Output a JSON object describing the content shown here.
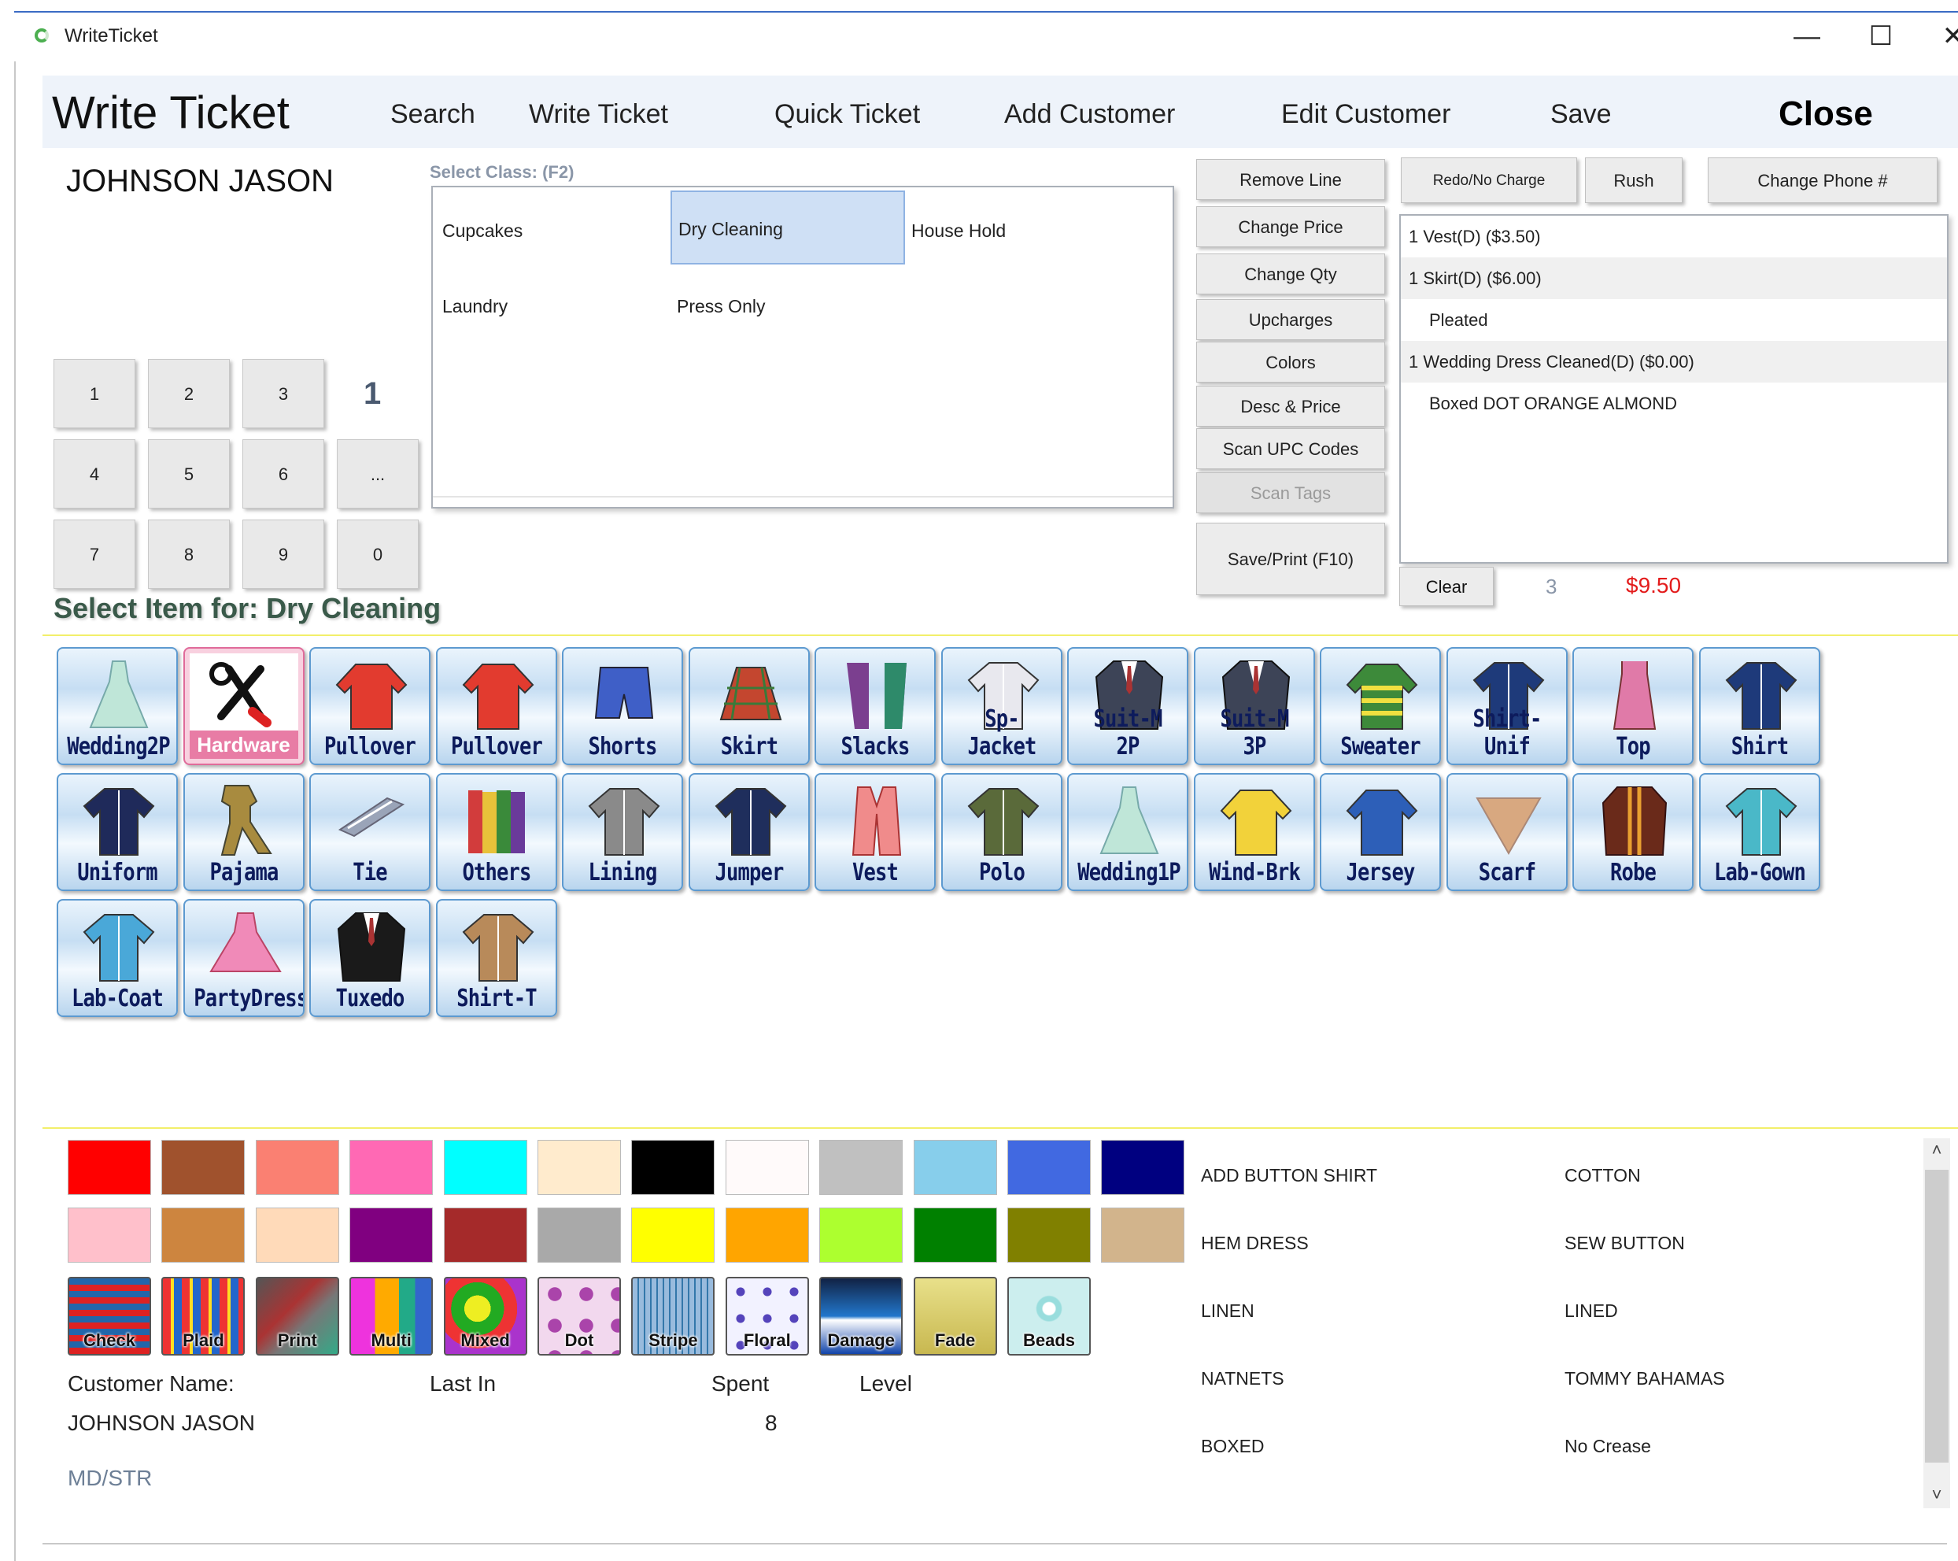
{
  "window": {
    "title": "WriteTicket",
    "minimize": "—",
    "maximize": "☐",
    "close": "✕"
  },
  "header": {
    "title": "Write Ticket",
    "nav": [
      "Search",
      "Write Ticket",
      "Quick Ticket",
      "Add Customer",
      "Edit Customer",
      "Save",
      "Close"
    ]
  },
  "customer": {
    "name": "JOHNSON JASON"
  },
  "keypad": {
    "keys": [
      "1",
      "2",
      "3",
      "4",
      "5",
      "6",
      "...",
      "7",
      "8",
      "9",
      "0"
    ],
    "display": "1"
  },
  "classes": {
    "label": "Select Class: (F2)",
    "items": [
      "Cupcakes",
      "Dry Cleaning",
      "House Hold",
      "Laundry",
      "Press Only"
    ],
    "selected": "Dry Cleaning"
  },
  "actions": [
    "Remove Line",
    "Change Price",
    "Change Qty",
    "Upcharges",
    "Colors",
    "Desc & Price",
    "Scan UPC Codes",
    "Scan Tags",
    "Save/Print (F10)"
  ],
  "ticket_buttons": [
    "Redo/No Charge",
    "Rush",
    "Change Phone #"
  ],
  "ticket": {
    "lines": [
      "1  Vest(D)   ($3.50)",
      "1  Skirt(D)   ($6.00)",
      "Pleated",
      "1  Wedding Dress Cleaned(D)   ($0.00)",
      "Boxed DOT ORANGE ALMOND"
    ],
    "clear": "Clear",
    "count": "3",
    "total": "$9.50"
  },
  "item_section": {
    "label": "Select Item for: Dry Cleaning"
  },
  "items": [
    "Wedding2P",
    "Hardware",
    "Pullover",
    "Pullover",
    "Shorts",
    "Skirt",
    "Slacks",
    "Sp-Jacket",
    "Suit-M 2P",
    "Suit-M 3P",
    "Sweater",
    "Shirt-Unif",
    "Top",
    "Shirt",
    "Uniform",
    "Pajama",
    "Tie",
    "Others",
    "Lining",
    "Jumper",
    "Vest",
    "Polo",
    "Wedding1P",
    "Wind-Brk",
    "Jersey",
    "Scarf",
    "Robe",
    "Lab-Gown",
    "Lab-Coat",
    "PartyDress",
    "Tuxedo",
    "Shirt-T"
  ],
  "colors": {
    "row1": [
      "#ff0000",
      "#a0522d",
      "#fa8072",
      "#ff69b4",
      "#00ffff",
      "#ffebcd",
      "#000000",
      "#fffafa",
      "#c0c0c0",
      "#87ceeb",
      "#4169e1",
      "#000080"
    ],
    "row2": [
      "#ffc0cb",
      "#cd853f",
      "#ffdab9",
      "#800080",
      "#a52a2a",
      "#a9a9a9",
      "#ffff00",
      "#ffa500",
      "#adff2f",
      "#008000",
      "#808000",
      "#d2b48c"
    ],
    "patterns": [
      "Check",
      "Plaid",
      "Print",
      "Multi",
      "Mixed",
      "Dot",
      "Stripe",
      "Floral",
      "Damage",
      "Fade",
      "Beads"
    ]
  },
  "customer_info": {
    "label_name": "Customer Name:",
    "label_last": "Last In",
    "label_spent": "Spent",
    "label_level": "Level",
    "name": "JOHNSON JASON",
    "spent": "8",
    "code": "MD/STR"
  },
  "upcharges": [
    "ADD BUTTON SHIRT",
    "COTTON",
    "HEM DRESS",
    "SEW BUTTON",
    "LINEN",
    "LINED",
    "NATNETS",
    "TOMMY BAHAMAS",
    "BOXED",
    "No Crease"
  ]
}
